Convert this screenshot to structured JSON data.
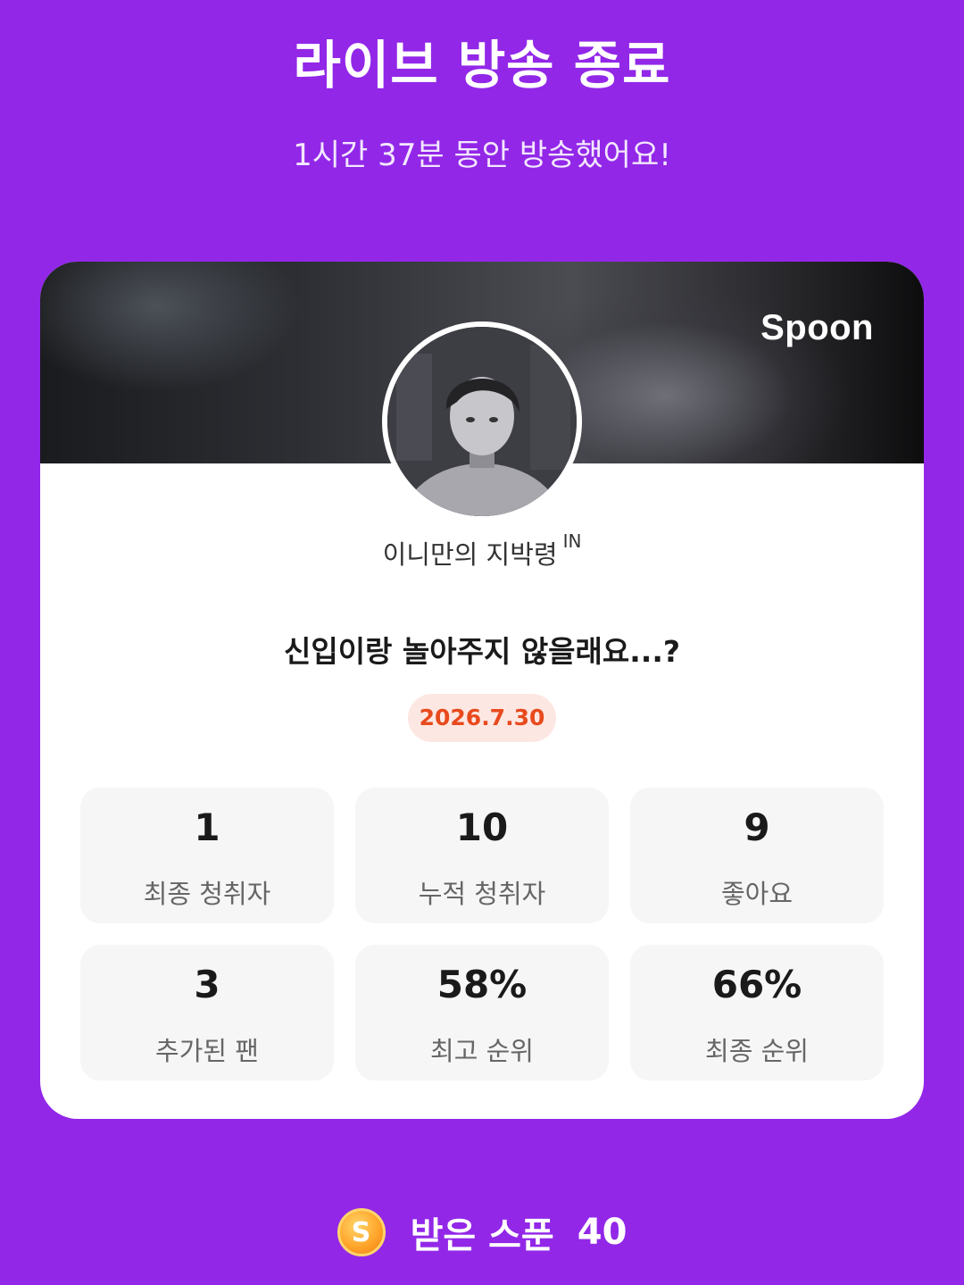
{
  "header": {
    "title": "라이브 방송 종료",
    "subtitle": "1시간 37분 동안 방송했어요!"
  },
  "card": {
    "brand": "Spoon",
    "dj_name": "이니만의 지박령",
    "dj_badge": "IN",
    "live_title": "신입이랑 놀아주지 않을래요...?",
    "date": "2026.7.30",
    "stats": [
      {
        "value": "1",
        "label": "최종 청취자"
      },
      {
        "value": "10",
        "label": "누적 청취자"
      },
      {
        "value": "9",
        "label": "좋아요"
      },
      {
        "value": "3",
        "label": "추가된 팬"
      },
      {
        "value": "58%",
        "label": "최고 순위"
      },
      {
        "value": "66%",
        "label": "최종 순위"
      }
    ]
  },
  "footer": {
    "coin_letter": "S",
    "received_label": "받은 스푼",
    "received_count": "40"
  },
  "colors": {
    "background": "#9227e8",
    "date_badge_bg": "#fde7e2",
    "date_badge_text": "#e84a1d",
    "coin": "#ffa62b"
  }
}
